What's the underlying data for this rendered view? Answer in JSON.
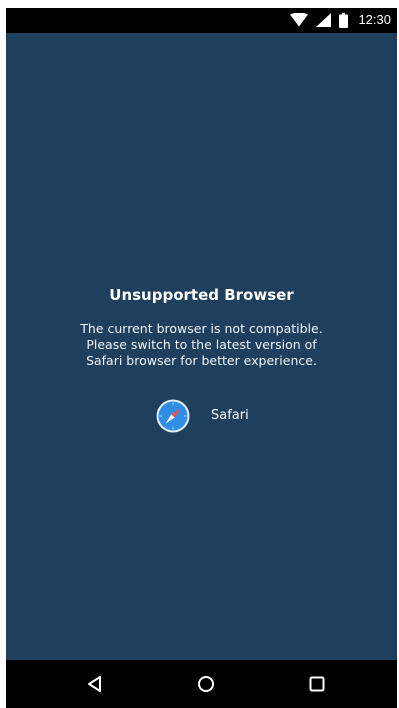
{
  "status_bar": {
    "time": "12:30",
    "icons": [
      "wifi-icon",
      "signal-icon",
      "battery-icon"
    ]
  },
  "screen": {
    "title": "Unsupported Browser",
    "message_lines": [
      "The current browser is not compatible.",
      "Please switch to the latest version of",
      "Safari browser for better experience."
    ],
    "browser_option": {
      "icon": "safari-compass-icon",
      "label": "Safari"
    }
  },
  "nav_bar": {
    "buttons": [
      "back-icon",
      "home-icon",
      "recents-icon"
    ]
  },
  "colors": {
    "background": "#1f3f5e",
    "system_bars": "#000000",
    "text": "#ffffff",
    "safari_blue": "#2f8de4"
  }
}
